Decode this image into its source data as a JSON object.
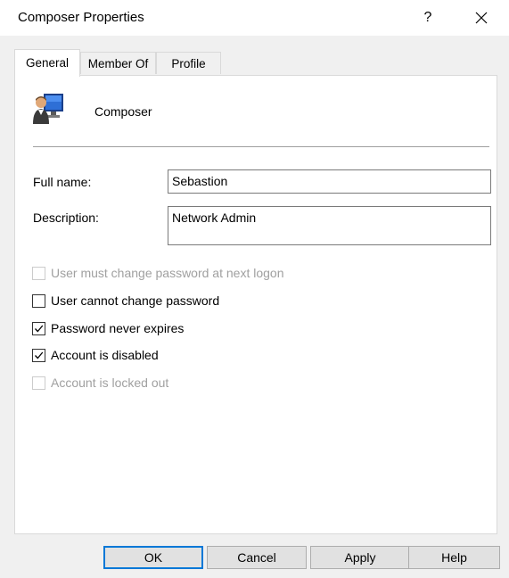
{
  "window": {
    "title": "Composer Properties",
    "help_glyph": "?",
    "close_icon": "close-icon"
  },
  "tabs": [
    {
      "label": "General",
      "active": true
    },
    {
      "label": "Member Of",
      "active": false
    },
    {
      "label": "Profile",
      "active": false
    }
  ],
  "general": {
    "user_display_name": "Composer",
    "user_icon": "user-computer-icon",
    "full_name_label": "Full name:",
    "full_name_value": "Sebastion",
    "description_label": "Description:",
    "description_value": "Network Admin",
    "options": [
      {
        "label": "User must change password at next logon",
        "checked": false,
        "enabled": false
      },
      {
        "label": "User cannot change password",
        "checked": false,
        "enabled": true
      },
      {
        "label": "Password never expires",
        "checked": true,
        "enabled": true
      },
      {
        "label": "Account is disabled",
        "checked": true,
        "enabled": true
      },
      {
        "label": "Account is locked out",
        "checked": false,
        "enabled": false
      }
    ]
  },
  "buttons": {
    "ok": "OK",
    "cancel": "Cancel",
    "apply": "Apply",
    "help": "Help"
  },
  "colors": {
    "default_button_border": "#0078d7",
    "disabled_text": "#a0a0a0"
  }
}
